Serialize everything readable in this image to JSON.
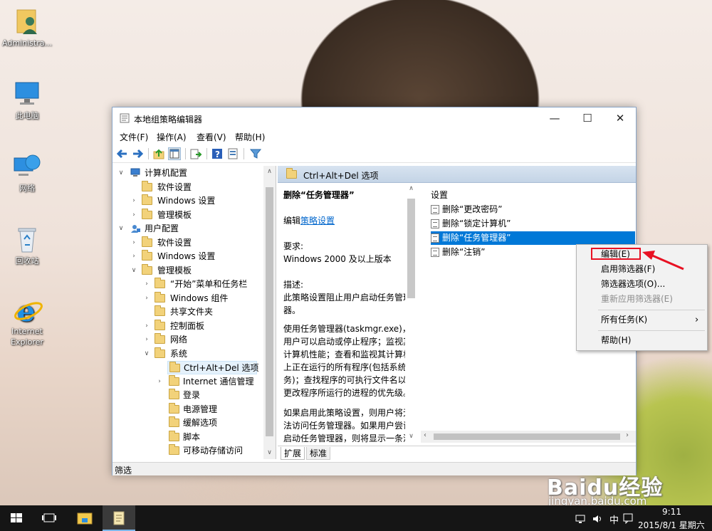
{
  "desktop": {
    "icons": [
      {
        "label": "Administra..."
      },
      {
        "label": "此电脑"
      },
      {
        "label": "网络"
      },
      {
        "label": "回收站"
      },
      {
        "label": "Internet Explorer"
      }
    ]
  },
  "window": {
    "title": "本地组策略编辑器",
    "controls": {
      "minimize": "—",
      "maximize": "☐",
      "close": "✕"
    },
    "menu": [
      "文件(F)",
      "操作(A)",
      "查看(V)",
      "帮助(H)"
    ],
    "tree": [
      {
        "label": "计算机配置"
      },
      {
        "label": "软件设置"
      },
      {
        "label": "Windows 设置"
      },
      {
        "label": "管理模板"
      },
      {
        "label": "用户配置"
      },
      {
        "label": "软件设置"
      },
      {
        "label": "Windows 设置"
      },
      {
        "label": "管理模板"
      },
      {
        "label": "“开始”菜单和任务栏"
      },
      {
        "label": "Windows 组件"
      },
      {
        "label": "共享文件夹"
      },
      {
        "label": "控制面板"
      },
      {
        "label": "网络"
      },
      {
        "label": "系统"
      },
      {
        "label": "Ctrl+Alt+Del 选项"
      },
      {
        "label": "Internet 通信管理"
      },
      {
        "label": "登录"
      },
      {
        "label": "电源管理"
      },
      {
        "label": "缓解选项"
      },
      {
        "label": "脚本"
      },
      {
        "label": "可移动存储访问"
      }
    ],
    "header": "Ctrl+Alt+Del 选项",
    "description": {
      "title": "删除“任务管理器”",
      "edit_prefix": "编辑",
      "edit_link": "策略设置",
      "req_label": "要求:",
      "req_value": "Windows 2000 及以上版本",
      "desc_label": "描述:",
      "desc_text": "此策略设置阻止用户启动任务管理器。",
      "para2": "使用任务管理器(taskmgr.exe)，用户可以启动或停止程序；监视其计算机性能；查看和监视其计算机上正在运行的所有程序(包括系统服务)；查找程序的可执行文件名以及更改程序所运行的进程的优先级。",
      "para3": "如果启用此策略设置，则用户将无法访问任务管理器。如果用户尝试启动任务管理器，则将显示一条消息，说明策略阻止了此操作。"
    },
    "settings_header": "设置",
    "settings": [
      {
        "label": "删除“更改密码”"
      },
      {
        "label": "删除“锁定计算机”"
      },
      {
        "label": "删除“任务管理器”"
      },
      {
        "label": "删除“注销”"
      }
    ],
    "tabs": [
      "扩展",
      "标准"
    ],
    "status": "筛选"
  },
  "context_menu": {
    "items": [
      {
        "label": "编辑(E)"
      },
      {
        "label": "启用筛选器(F)"
      },
      {
        "label": "筛选器选项(O)..."
      },
      {
        "label": "重新应用筛选器(E)"
      },
      {
        "label": "所有任务(K)"
      },
      {
        "label": "帮助(H)"
      }
    ],
    "highlight_color": "#e81123",
    "submenu_arrow": "›"
  },
  "taskbar": {
    "time": "9:11",
    "date": "2015/8/1 星期六",
    "ime": "中"
  },
  "watermark": {
    "brand": "Baidu经验",
    "url": "jingyan.baidu.com"
  },
  "colors": {
    "selection": "#0078d7",
    "link": "#0066cc",
    "accent": "#3c7fb1"
  }
}
